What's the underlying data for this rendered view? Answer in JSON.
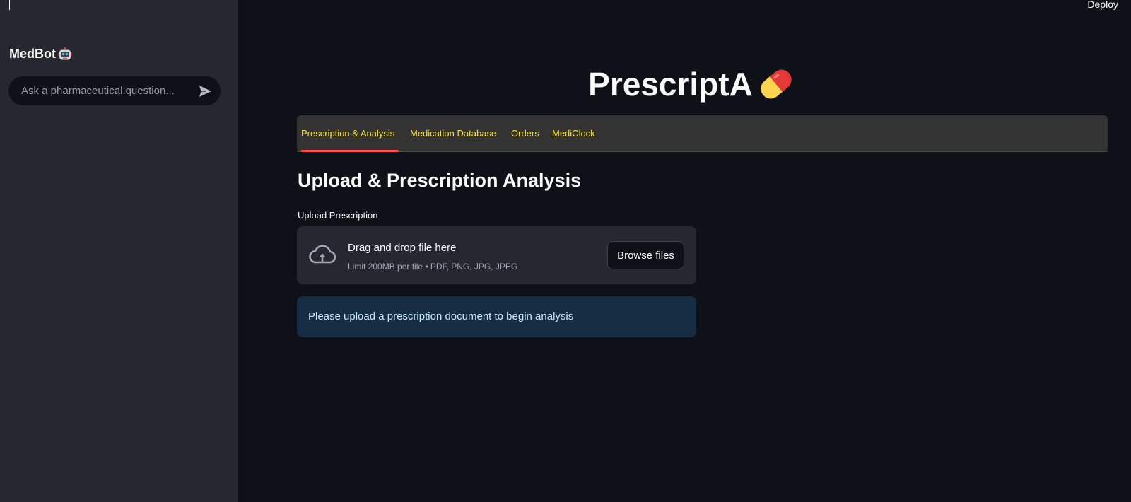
{
  "header": {
    "deploy_label": "Deploy"
  },
  "sidebar": {
    "title": "MedBot",
    "title_icon": "robot-icon",
    "chat": {
      "placeholder": "Ask a pharmaceutical question...",
      "value": "",
      "send_icon": "send-icon"
    }
  },
  "main": {
    "app_title": "PrescriptA",
    "app_title_icon": "pill-icon",
    "tabs": [
      {
        "label": "Prescription & Analysis",
        "active": true
      },
      {
        "label": "Medication Database",
        "active": false
      },
      {
        "label": "Orders",
        "active": false
      },
      {
        "label": "MediClock",
        "active": false
      }
    ],
    "section_heading": "Upload & Prescription Analysis",
    "uploader": {
      "label": "Upload Prescription",
      "icon": "cloud-upload-icon",
      "drop_text": "Drag and drop file here",
      "limit_text": "Limit 200MB per file • PDF, PNG, JPG, JPEG",
      "browse_label": "Browse files"
    },
    "info_message": "Please upload a prescription document to begin analysis"
  },
  "colors": {
    "background": "#0e1117",
    "sidebar": "#262730",
    "tab_text": "#f5e23a",
    "tab_active_indicator": "#ff4b4b",
    "info_background": "#172d43",
    "info_text": "#c7ebff"
  }
}
